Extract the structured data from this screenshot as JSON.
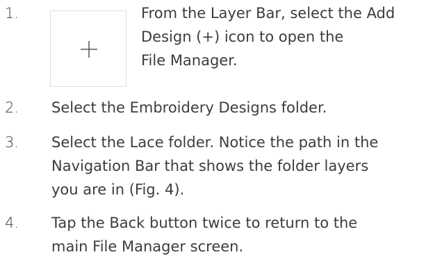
{
  "steps": [
    {
      "number": "1.",
      "lines": [
        "From the Layer Bar, select the Add",
        "Design (+) icon to open the",
        "File Manager."
      ],
      "icon": "plus-icon"
    },
    {
      "number": "2.",
      "lines": [
        "Select the Embroidery Designs folder."
      ]
    },
    {
      "number": "3.",
      "lines": [
        "Select the Lace folder. Notice the path in the",
        "Navigation Bar that shows the folder layers",
        "you are in (Fig. 4)."
      ]
    },
    {
      "number": "4.",
      "lines": [
        "Tap the Back button twice to return to the",
        "main File Manager screen."
      ]
    }
  ],
  "colors": {
    "text": "#3c3c3c",
    "icon_border": "#dedede",
    "icon_stroke": "#3c3c3c"
  }
}
